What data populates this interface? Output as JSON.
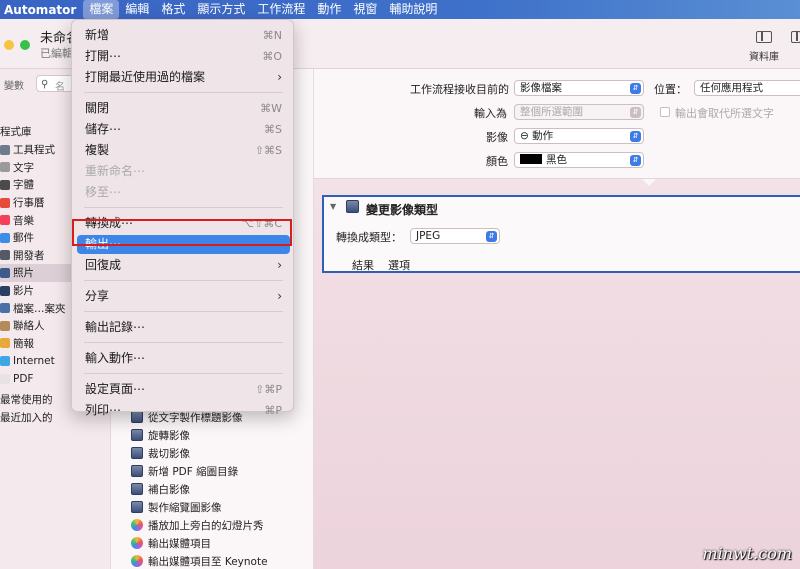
{
  "menubar": {
    "app": "Automator",
    "items": [
      "檔案",
      "編輯",
      "格式",
      "顯示方式",
      "工作流程",
      "動作",
      "視窗",
      "輔助說明"
    ]
  },
  "window": {
    "title": "未命名",
    "subtitle": "已編輯",
    "toolbar": {
      "library_label": "資料庫"
    }
  },
  "library": {
    "search_label": "變數",
    "search_placeholder": "名",
    "header": "程式庫",
    "items": [
      {
        "label": "工具程式",
        "color": "#6d7b8d"
      },
      {
        "label": "文字",
        "color": "#9a9a9a"
      },
      {
        "label": "字體",
        "color": "#4b4b4b"
      },
      {
        "label": "行事曆",
        "color": "#e64b3c"
      },
      {
        "label": "音樂",
        "color": "#f5405a"
      },
      {
        "label": "郵件",
        "color": "#3d8ce8"
      },
      {
        "label": "開發者",
        "color": "#555b66"
      },
      {
        "label": "照片",
        "color": "#3e5a8a"
      },
      {
        "label": "影片",
        "color": "#2b3f63"
      },
      {
        "label": "檔案…案夾",
        "color": "#4c6fa8"
      },
      {
        "label": "聯絡人",
        "color": "#b48a5a"
      },
      {
        "label": "簡報",
        "color": "#e8a93a"
      },
      {
        "label": "Internet",
        "color": "#3fa6e6"
      },
      {
        "label": "PDF",
        "color": "#e8e2e4"
      }
    ],
    "footer": [
      "最常使用的",
      "最近加入的"
    ]
  },
  "actions_list": [
    {
      "label": "從文字製作標題影像",
      "icon": "image-icon"
    },
    {
      "label": "旋轉影像",
      "icon": "image-icon"
    },
    {
      "label": "裁切影像",
      "icon": "image-icon"
    },
    {
      "label": "新增 PDF 縮圖目錄",
      "icon": "image-icon"
    },
    {
      "label": "補白影像",
      "icon": "image-icon"
    },
    {
      "label": "製作縮覽圖影像",
      "icon": "image-icon"
    },
    {
      "label": "播放加上旁白的幻燈片秀",
      "icon": "photos-icon"
    },
    {
      "label": "輸出媒體項目",
      "icon": "photos-icon"
    },
    {
      "label": "輸出媒體項目至 Keynote",
      "icon": "photos-icon"
    }
  ],
  "workflow": {
    "receives_label": "工作流程接收目前的",
    "receives_value": "影像檔案",
    "location_label": "位置：",
    "location_value": "任何應用程式",
    "input_label": "輸入為",
    "input_value": "整個所選範圍",
    "replace_label": "輸出會取代所選文字",
    "image_label": "影像",
    "image_value": "⊖ 動作",
    "color_label": "顏色",
    "color_value": "黑色",
    "color_swatch": "#000000"
  },
  "action_card": {
    "title": "變更影像類型",
    "convert_label": "轉換成類型：",
    "convert_value": "JPEG",
    "tabs": [
      "結果",
      "選項"
    ]
  },
  "file_menu": {
    "items": [
      {
        "label": "新增",
        "shortcut": "⌘N"
      },
      {
        "label": "打開⋯",
        "shortcut": "⌘O"
      },
      {
        "label": "打開最近使用過的檔案",
        "submenu": true
      },
      {
        "label": "關閉",
        "shortcut": "⌘W"
      },
      {
        "label": "儲存⋯",
        "shortcut": "⌘S"
      },
      {
        "label": "複製",
        "shortcut": "⇧⌘S"
      },
      {
        "label": "重新命名⋯",
        "disabled": true
      },
      {
        "label": "移至⋯",
        "disabled": true
      },
      {
        "label": "轉換成⋯",
        "shortcut": "⌥⇧⌘C"
      },
      {
        "label": "輸出⋯",
        "highlighted": true
      },
      {
        "label": "回復成",
        "submenu": true
      },
      {
        "label": "分享",
        "submenu": true
      },
      {
        "label": "輸出記錄⋯"
      },
      {
        "label": "輸入動作⋯"
      },
      {
        "label": "設定頁面⋯",
        "shortcut": "⇧⌘P"
      },
      {
        "label": "列印⋯",
        "shortcut": "⌘P"
      }
    ]
  },
  "colors": {
    "accent": "#3d85e6",
    "highlight_outline": "#d91c1c",
    "card_border": "#2f5fb8"
  },
  "watermark": "minwt.com"
}
